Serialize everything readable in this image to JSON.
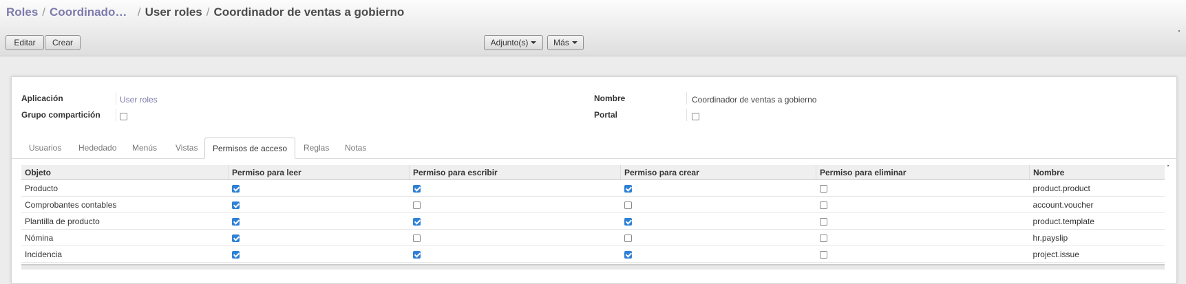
{
  "breadcrumb": {
    "items": [
      "Roles",
      "Coordinado…",
      "User roles",
      "Coordinador de ventas a gobierno"
    ]
  },
  "toolbar": {
    "edit_label": "Editar",
    "create_label": "Crear",
    "attachments_label": "Adjunto(s)",
    "more_label": "Más"
  },
  "form": {
    "application_label": "Aplicación",
    "application_value": "User roles",
    "share_group_label": "Grupo compartición",
    "share_group_checked": false,
    "name_label": "Nombre",
    "name_value": "Coordinador de ventas a gobierno",
    "portal_label": "Portal",
    "portal_checked": false
  },
  "tabs": [
    {
      "label": "Usuarios",
      "active": false
    },
    {
      "label": "Hededado",
      "active": false
    },
    {
      "label": "Menús",
      "active": false
    },
    {
      "label": "Vistas",
      "active": false
    },
    {
      "label": "Permisos de acceso",
      "active": true
    },
    {
      "label": "Reglas",
      "active": false
    },
    {
      "label": "Notas",
      "active": false
    }
  ],
  "access_table": {
    "columns": [
      "Objeto",
      "Permiso para leer",
      "Permiso para escribir",
      "Permiso para crear",
      "Permiso para eliminar",
      "Nombre"
    ],
    "rows": [
      {
        "object": "Producto",
        "read": true,
        "write": true,
        "create": true,
        "delete": false,
        "name": "product.product"
      },
      {
        "object": "Comprobantes contables",
        "read": true,
        "write": false,
        "create": false,
        "delete": false,
        "name": "account.voucher"
      },
      {
        "object": "Plantilla de producto",
        "read": true,
        "write": true,
        "create": true,
        "delete": false,
        "name": "product.template"
      },
      {
        "object": "Nómina",
        "read": true,
        "write": false,
        "create": false,
        "delete": false,
        "name": "hr.payslip"
      },
      {
        "object": "Incidencia",
        "read": true,
        "write": true,
        "create": true,
        "delete": false,
        "name": "project.issue"
      }
    ]
  },
  "colors": {
    "link": "#7c7bad",
    "checkbox_checked": "#2f80d7"
  },
  "icons": {
    "dropdown": "caret-down-icon",
    "checkbox": "checkbox-icon"
  }
}
